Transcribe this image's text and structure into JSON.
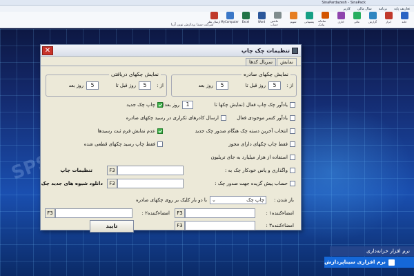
{
  "app": {
    "window_title": "SinaPardazesh - SinaPack",
    "menus": [
      "تعاریف پایه",
      "برنامه",
      "سال مالی",
      "کاربر"
    ],
    "ribbon": [
      {
        "label": "خانه",
        "icon": "home-icon",
        "color": "#2a64c4"
      },
      {
        "label": "ابزار",
        "icon": "tools-icon",
        "color": "#c0392b"
      },
      {
        "label": "گزارش",
        "icon": "report-icon",
        "color": "#2e86c1"
      },
      {
        "label": "مالی",
        "icon": "money-icon",
        "color": "#27ae60"
      },
      {
        "label": "اداری",
        "icon": "office-icon",
        "color": "#8e44ad"
      },
      {
        "label": "سامانه پیامک",
        "icon": "sms-icon",
        "color": "#d35400"
      },
      {
        "label": "پشتیبانی",
        "icon": "support-icon",
        "color": "#16a085"
      },
      {
        "label": "تقویم",
        "icon": "calendar-icon",
        "color": "#e67e22"
      },
      {
        "label": "ماشین حساب",
        "icon": "calculator-icon",
        "color": "#7f8c8d"
      },
      {
        "label": "Word",
        "icon": "word-icon",
        "color": "#2b579a"
      },
      {
        "label": "Excel",
        "icon": "excel-icon",
        "color": "#217346"
      },
      {
        "label": "MyComputer",
        "icon": "computer-icon",
        "color": "#3a77c7"
      },
      {
        "label": "ارسال نظر",
        "icon": "feedback-icon",
        "color": "#c0392b"
      }
    ],
    "company": "شرکت سینا پردازش نوین آریا"
  },
  "dialog": {
    "title": "تنظیمات چک چاپ",
    "tabs": [
      "نمایش",
      "سریال کدها"
    ],
    "issued": {
      "title": "نمایش چکهای صادره",
      "from_label": "از :",
      "from_value": "5",
      "days_before": "روز قبل تا",
      "to_value": "5",
      "days_after": "روز بعد"
    },
    "received": {
      "title": "نمایش چکهای دریافتی",
      "from_label": "از :",
      "from_value": "5",
      "days_before": "روز قبل تا",
      "to_value": "5",
      "days_after": "روز بعد"
    },
    "options_right": [
      {
        "label": "یادآور چک چاپ فعال (نمایش چکها تا",
        "checked": false
      },
      {
        "label": "یادآور کسر موجودی فعال",
        "checked": false
      },
      {
        "label": "انتخاب آخرین دسته چک هنگام صدور چک جدید",
        "checked": false
      },
      {
        "label": "فقط چاپ چکهای دارای مجوز",
        "checked": false
      },
      {
        "label": "استفاده از هزار میلیارد به جای تریلیون",
        "checked": false
      }
    ],
    "reminder_days": "1",
    "reminder_suffix": "روز بعد)",
    "options_left": [
      {
        "label": "چاپ چک جدید",
        "checked": true
      },
      {
        "label": "ارسال کادرهای تکراری در رسید چکهای صادره",
        "checked": false
      },
      {
        "label": "عدم نمایش فرم ثبت رسیدها",
        "checked": true
      },
      {
        "label": "فقط چاپ رسید چکهای قطعی شده",
        "checked": false
      }
    ],
    "assign_label": "واگذاری و پاس خودکار چک به :",
    "temp_account_label": "حساب پیش گزیده جهت صدور چک :",
    "print_settings": "تنظیمات چاپ",
    "download_templates": "دانلود شیوه های جدید چک",
    "f3": "F3",
    "open_label": "باز شدن :",
    "open_value": "چاپ چک",
    "open_hint": "با دو بار کلیک بر روی چکهای صادره",
    "signer1": "امضاءکننده۱ :",
    "signer2": "امضاءکننده۲ :",
    "signer3": "امضاءکننده۳ :",
    "confirm": "تایید"
  },
  "brand": {
    "line1": "نرم افزار خزانه‌داری",
    "line2": "نرم افزاری سیناپردازش"
  }
}
